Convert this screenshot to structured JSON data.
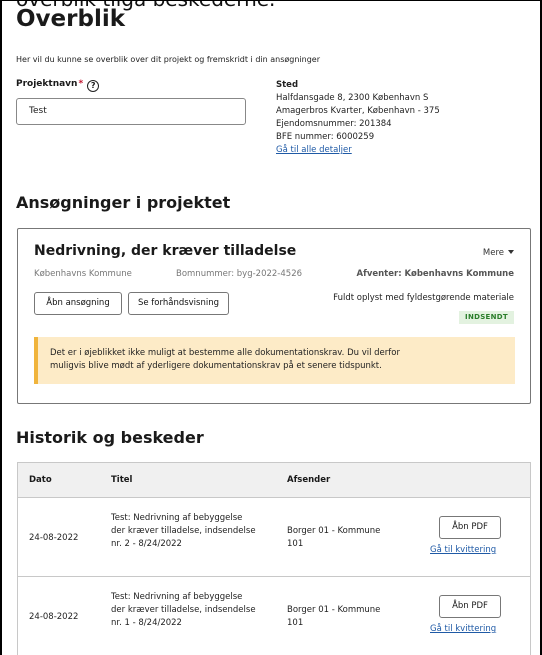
{
  "cutoff_text": "overblik tilgå beskederne.",
  "page": {
    "title": "Overblik",
    "subtitle": "Her vil du kunne se overblik over dit projekt og fremskridt i din ansøgninger"
  },
  "project": {
    "label": "Projektnavn",
    "required_mark": "*",
    "help_icon": "?",
    "value": "Test"
  },
  "location": {
    "heading": "Sted",
    "address": "Halfdansgade 8, 2300 København S",
    "district": "Amagerbros Kvarter, København - 375",
    "property_number": "Ejendomsnummer: 201384",
    "bfe_number": "BFE nummer: 6000259",
    "details_link": "Gå til alle detaljer"
  },
  "applications": {
    "heading": "Ansøgninger i projektet",
    "card": {
      "title": "Nedrivning, der kræver tilladelse",
      "more_label": "Mere",
      "municipality": "Københavns Kommune",
      "building_number": "Bomnummer: byg-2022-4526",
      "awaiting": "Afventer: Københavns Kommune",
      "open_button": "Åbn ansøgning",
      "preview_button": "Se forhåndsvisning",
      "status_text": "Fuldt oplyst med fyldestgørende materiale",
      "badge": "INDSENDT",
      "alert_line1": "Det er i øjeblikket ikke muligt at bestemme alle dokumentationskrav. Du vil derfor",
      "alert_line2": "muligvis blive mødt af yderligere dokumentationskrav på et senere tidspunkt."
    }
  },
  "history": {
    "heading": "Historik og beskeder",
    "columns": [
      "Dato",
      "Titel",
      "Afsender"
    ],
    "rows": [
      {
        "date": "24-08-2022",
        "title_l1": "Test: Nedrivning af bebyggelse",
        "title_l2": "der kræver tilladelse, indsendelse",
        "title_l3": "nr. 2 - 8/24/2022",
        "sender_l1": "Borger 01 - Kommune",
        "sender_l2": "101",
        "pdf_button": "Åbn PDF",
        "receipt_link": "Gå til kvittering"
      },
      {
        "date": "24-08-2022",
        "title_l1": "Test: Nedrivning af bebyggelse",
        "title_l2": "der kræver tilladelse, indsendelse",
        "title_l3": "nr. 1 - 8/24/2022",
        "sender_l1": "Borger 01 - Kommune",
        "sender_l2": "101",
        "pdf_button": "Åbn PDF",
        "receipt_link": "Gå til kvittering"
      }
    ]
  },
  "colors": {
    "required": "#c0152f",
    "link": "#1f5aa6",
    "badge_bg": "#e3f2e0",
    "badge_text": "#2a7d2a",
    "alert_bg": "#fdebc7",
    "alert_border": "#f0b43c",
    "table_header_bg": "#f0f0f0"
  }
}
